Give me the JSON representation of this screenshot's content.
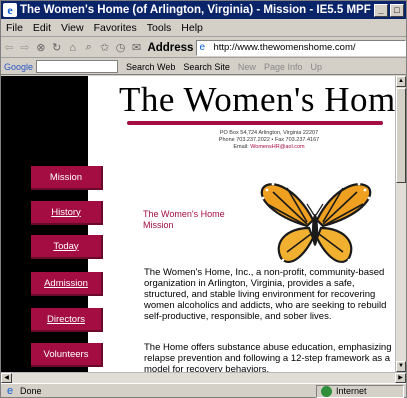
{
  "window": {
    "title": "The Women's Home (of Arlington, Virginia) - Mission - IE5.5 MPF"
  },
  "menu": [
    "File",
    "Edit",
    "View",
    "Favorites",
    "Tools",
    "Help"
  ],
  "toolbar": {
    "address_label": "Address",
    "url": "http://www.thewomenshome.com/"
  },
  "googlebar": {
    "logo": "Google",
    "search_web": "Search Web",
    "search_site": "Search Site",
    "new": "New",
    "page_info": "Page Info",
    "up": "Up"
  },
  "page": {
    "heading": "The Women's Home",
    "address_line1": "PO Box 54,724 Arlington, Virginia 22207",
    "address_line2": "Phone 703.237.2022 • Fax 703.237.4167",
    "email_prefix": "Email:",
    "email": "WomensHR@aol.com",
    "mission_label_1": "The Women's Home",
    "mission_label_2": "Mission",
    "paragraph1": "The Women's Home, Inc., a non-profit, community-based organization in Arlington, Virginia, provides a safe, structured, and stable living environment for recovering women alcoholics and addicts, who are seeking to rebuild self-productive, responsible, and sober lives.",
    "paragraph2": "The Home offers substance abuse education, emphasizing relapse prevention and following a 12-step framework as a model for recovery behaviors."
  },
  "nav": [
    {
      "label": "Mission"
    },
    {
      "label": "History"
    },
    {
      "label": "Today"
    },
    {
      "label": "Admission"
    },
    {
      "label": "Directors"
    },
    {
      "label": "Volunteers"
    }
  ],
  "status": {
    "text": "Done",
    "zone": "Internet"
  },
  "colors": {
    "accent": "#a30d42",
    "titlebar": "#0a246a",
    "sidebar": "#000000"
  }
}
